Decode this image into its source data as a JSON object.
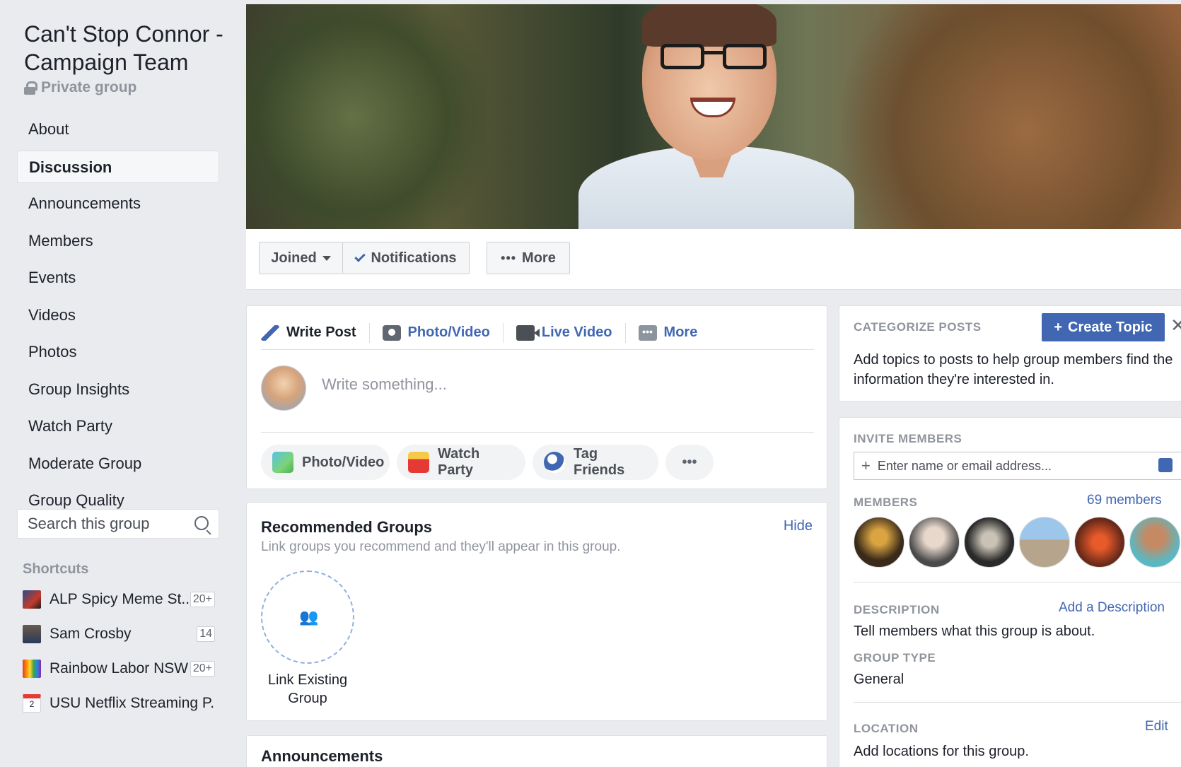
{
  "group": {
    "title": "Can't Stop Connor - Campaign Team",
    "privacy": "Private group"
  },
  "nav": {
    "items": [
      "About",
      "Discussion",
      "Announcements",
      "Members",
      "Events",
      "Videos",
      "Photos",
      "Group Insights",
      "Watch Party",
      "Moderate Group",
      "Group Quality"
    ],
    "active": "Discussion"
  },
  "search": {
    "placeholder": "Search this group"
  },
  "shortcuts": {
    "heading": "Shortcuts",
    "items": [
      {
        "label": "ALP Spicy Meme St...",
        "count": "20+"
      },
      {
        "label": "Sam Crosby",
        "count": "14"
      },
      {
        "label": "Rainbow Labor NSW",
        "count": "20+"
      },
      {
        "label": "USU Netflix Streaming P...",
        "count": ""
      }
    ]
  },
  "actions": {
    "joined": "Joined",
    "notifications": "Notifications",
    "more": "More"
  },
  "composer": {
    "tabs": [
      "Write Post",
      "Photo/Video",
      "Live Video",
      "More"
    ],
    "placeholder": "Write something...",
    "pills": [
      "Photo/Video",
      "Watch Party",
      "Tag Friends"
    ]
  },
  "recommended": {
    "title": "Recommended Groups",
    "subtitle": "Link groups you recommend and they'll appear in this group.",
    "hide": "Hide",
    "link_label": "Link Existing Group"
  },
  "announcements": {
    "title": "Announcements"
  },
  "categorize": {
    "heading": "CATEGORIZE POSTS",
    "button": "Create Topic",
    "text": "Add topics to posts to help group members find the information they're interested in."
  },
  "invite": {
    "heading": "INVITE MEMBERS",
    "placeholder": "Enter name or email address..."
  },
  "members": {
    "heading": "MEMBERS",
    "count": "69 members"
  },
  "description": {
    "heading": "DESCRIPTION",
    "link": "Add a Description",
    "text": "Tell members what this group is about."
  },
  "group_type": {
    "heading": "GROUP TYPE",
    "value": "General"
  },
  "location": {
    "heading": "LOCATION",
    "link": "Edit",
    "text": "Add locations for this group."
  },
  "colors": {
    "brand_blue": "#4267b2",
    "page_bg": "#e9ebee",
    "muted_text": "#90949c"
  }
}
